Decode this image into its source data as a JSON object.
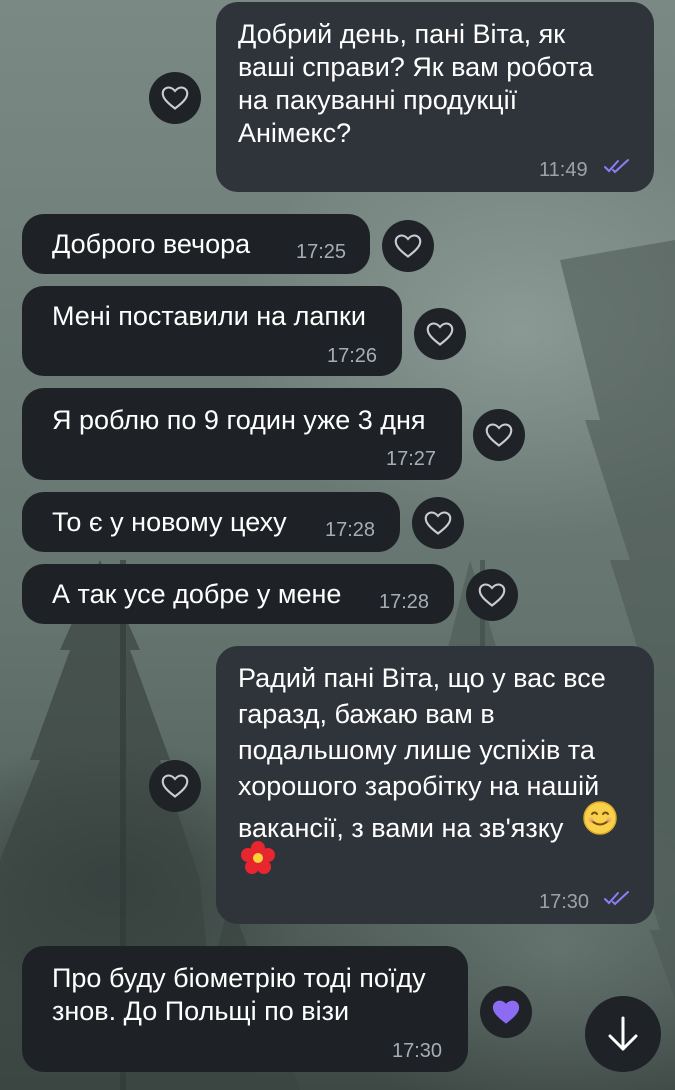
{
  "messages": [
    {
      "direction": "outgoing",
      "lines": [
        "Добрий день, пані Віта, як",
        "ваші справи? Як вам робота",
        "на пакуванні продукції",
        "Анімекс?"
      ],
      "time": "11:49",
      "status": "read",
      "reaction": "heart-outline"
    },
    {
      "direction": "incoming",
      "lines": [
        "Доброго вечора"
      ],
      "time": "17:25",
      "reaction": "heart-outline"
    },
    {
      "direction": "incoming",
      "lines": [
        "Мені поставили на лапки"
      ],
      "time": "17:26",
      "reaction": "heart-outline"
    },
    {
      "direction": "incoming",
      "lines": [
        "Я роблю по 9 годин уже 3 дня"
      ],
      "time": "17:27",
      "reaction": "heart-outline"
    },
    {
      "direction": "incoming",
      "lines": [
        "То є у новому цеху"
      ],
      "time": "17:28",
      "reaction": "heart-outline"
    },
    {
      "direction": "incoming",
      "lines": [
        "А так усе добре у мене"
      ],
      "time": "17:28",
      "reaction": "heart-outline"
    },
    {
      "direction": "outgoing",
      "lines": [
        "Радий пані Віта, що у вас все",
        "гаразд, бажаю вам в",
        "подальшому лише успіхів та",
        "хорошого заробітку на нашій",
        "вакансії, з вами на зв'язку"
      ],
      "emojis": [
        "smiling-face-emoji",
        "flower-emoji"
      ],
      "time": "17:30",
      "status": "read",
      "reaction": "heart-outline"
    },
    {
      "direction": "incoming",
      "lines": [
        "Про буду біометрію тоді поїду",
        "знов. До Польщі по візи"
      ],
      "time": "17:30",
      "reaction": "heart-filled"
    }
  ],
  "icons": {
    "reaction_outline": "heart-outline-icon",
    "reaction_filled": "heart-filled-icon",
    "read_status": "double-check-icon",
    "scroll": "arrow-down-icon"
  },
  "colors": {
    "incoming_bubble": "#1e2226",
    "outgoing_bubble": "#2f343b",
    "timestamp": "#9aa3ac",
    "read_ticks": "#8f7cf7",
    "filled_heart": "#8b6cf2"
  }
}
